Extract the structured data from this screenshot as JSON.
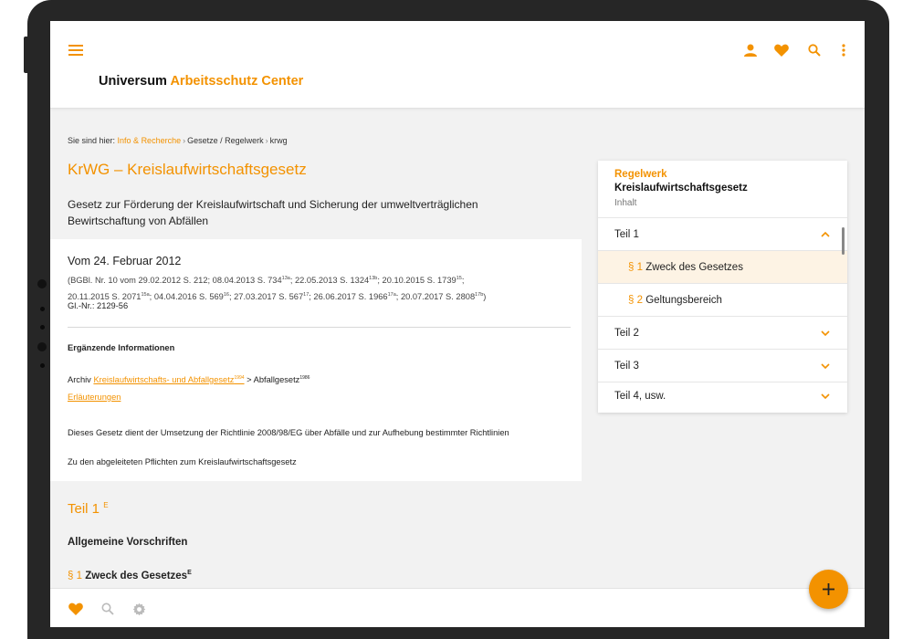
{
  "header": {
    "brand_main": "Universum",
    "brand_accent": "Arbeitsschutz Center",
    "icons": [
      "menu-icon",
      "person-icon",
      "heart-icon",
      "search-icon",
      "more-vert-icon"
    ]
  },
  "breadcrumb": {
    "prefix": "Sie sind hier:",
    "items": [
      "Info & Recherche",
      "Gesetze / Regelwerk",
      "krwg"
    ]
  },
  "document": {
    "title": "KrWG – Kreislaufwirtschaftsgesetz",
    "subtitle": "Gesetz zur Förderung der Kreislaufwirtschaft und Sicherung der umweltverträglichen Bewirtschaftung von Abfällen",
    "date": "Vom 24. Februar 2012",
    "bgbl_line1": "(BGBl. Nr. 10 vom 29.02.2012 S. 212; 08.04.2013 S. 734",
    "bgbl_line1_sup1": "13a",
    "bgbl_line1_b": "; 22.05.2013 S. 1324",
    "bgbl_line1_sup2": "13b",
    "bgbl_line1_c": "; 20.10.2015 S. 1739",
    "bgbl_line1_sup3": "15",
    "bgbl_line1_d": ";",
    "bgbl_line2": "20.11.2015 S. 2071",
    "bgbl_line2_sup1": "15a",
    "bgbl_line2_b": "; 04.04.2016 S. 569",
    "bgbl_line2_sup2": "16",
    "bgbl_line2_c": "; 27.03.2017 S. 567",
    "bgbl_line2_sup3": "17",
    "bgbl_line2_d": "; 26.06.2017 S. 1966",
    "bgbl_line2_sup4": "17a",
    "bgbl_line2_e": "; 20.07.2017 S. 2808",
    "bgbl_line2_sup5": "17b",
    "bgbl_line2_f": ")",
    "gl_nr": "Gl.-Nr.: 2129-56",
    "ergaenzende_heading": "Ergänzende Informationen",
    "archiv_prefix": "Archiv",
    "archiv_link": "Kreislaufwirtschafts- und Abfallgesetz",
    "archiv_link_sup": "1994",
    "archiv_suffix": "> Abfallgesetz",
    "archiv_suffix_sup": "1986",
    "erlaeuterungen": "Erläuterungen",
    "note": "Dieses Gesetz dient der Umsetzung der Richtlinie 2008/98/EG über Abfälle und zur Aufhebung bestimmter Richtlinien",
    "note2": "Zu den abgeleiteten Pflichten zum Kreislaufwirtschaftsgesetz",
    "teil_title": "Teil 1",
    "teil_sup": "E",
    "allgemeine": "Allgemeine Vorschriften",
    "para_sign": "§ 1",
    "para_title": "Zweck des Gesetzes",
    "para_sup": "E"
  },
  "toc": {
    "label": "Regelwerk",
    "name": "Kreislaufwirtschaftsgesetz",
    "inhalt": "Inhalt",
    "rows": [
      {
        "label": "Teil 1",
        "expanded": true
      },
      {
        "sign": "§ 1",
        "label": "Zweck des Gesetzes",
        "active": true
      },
      {
        "sign": "§ 2",
        "label": "Geltungsbereich"
      },
      {
        "label": "Teil 2"
      },
      {
        "label": "Teil 3"
      },
      {
        "label": "Teil 4, usw."
      }
    ]
  },
  "bottom_nav": {
    "icons": [
      "heart-icon",
      "search-icon",
      "settings-icon"
    ]
  },
  "fab": {
    "icon": "plus-icon"
  },
  "colors": {
    "accent": "#f39200",
    "active_row": "#fdf3e4",
    "background": "#f2f2f2"
  }
}
